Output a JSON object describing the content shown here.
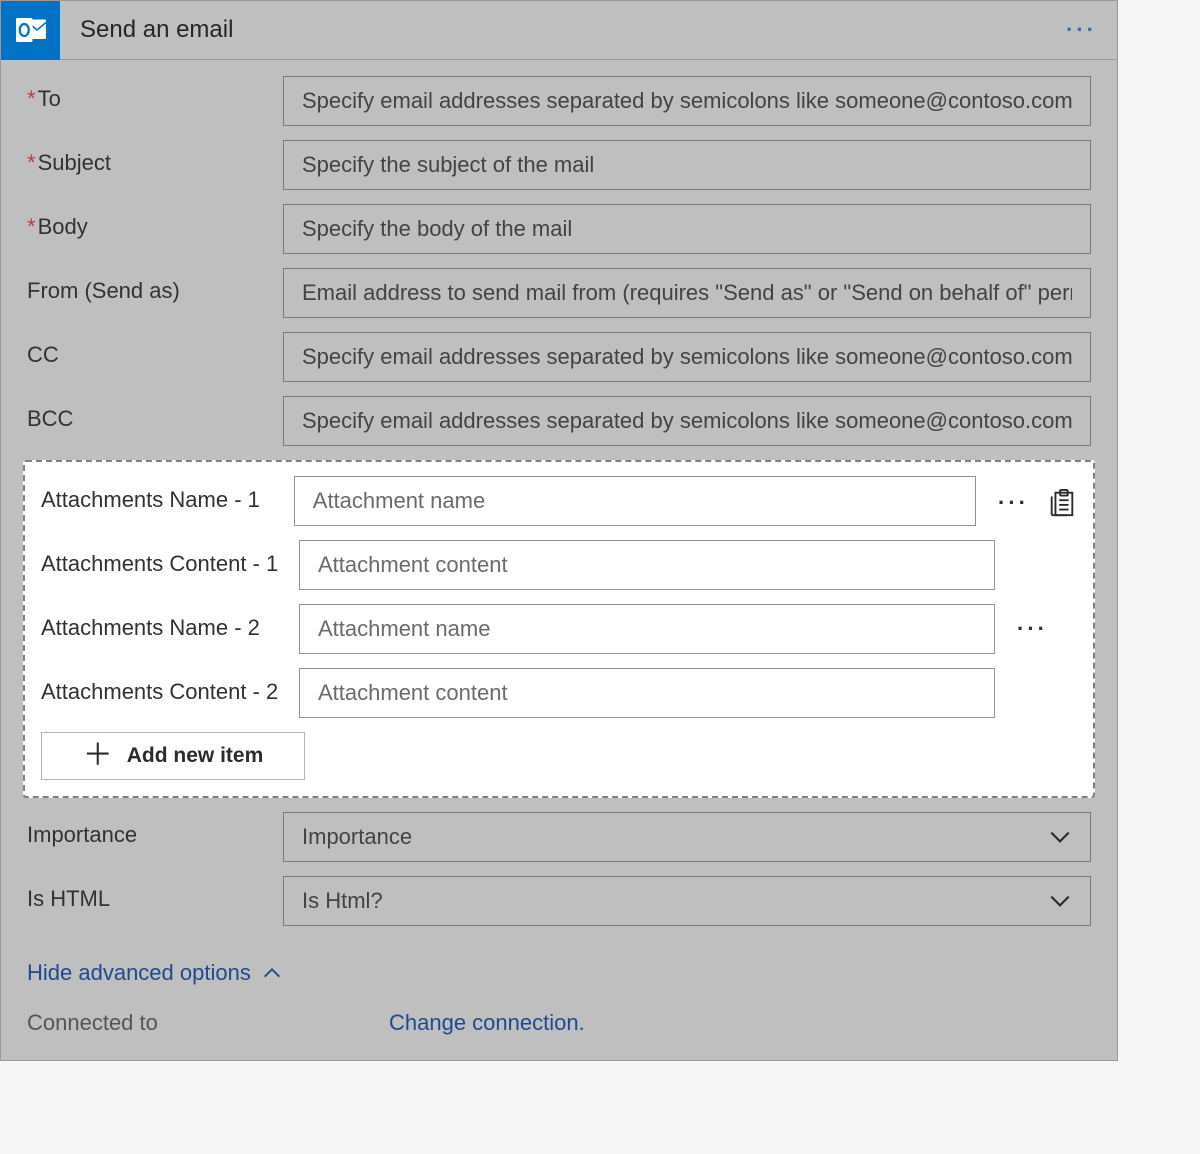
{
  "header": {
    "title": "Send an email"
  },
  "fields": {
    "to": {
      "label": "To",
      "required": true,
      "placeholder": "Specify email addresses separated by semicolons like someone@contoso.com"
    },
    "subject": {
      "label": "Subject",
      "required": true,
      "placeholder": "Specify the subject of the mail"
    },
    "body": {
      "label": "Body",
      "required": true,
      "placeholder": "Specify the body of the mail"
    },
    "from": {
      "label": "From (Send as)",
      "required": false,
      "placeholder": "Email address to send mail from (requires \"Send as\" or \"Send on behalf of\" permission)"
    },
    "cc": {
      "label": "CC",
      "required": false,
      "placeholder": "Specify email addresses separated by semicolons like someone@contoso.com"
    },
    "bcc": {
      "label": "BCC",
      "required": false,
      "placeholder": "Specify email addresses separated by semicolons like someone@contoso.com"
    }
  },
  "attachments": {
    "items": [
      {
        "name_label": "Attachments Name - 1",
        "name_placeholder": "Attachment name",
        "content_label": "Attachments Content - 1",
        "content_placeholder": "Attachment content"
      },
      {
        "name_label": "Attachments Name - 2",
        "name_placeholder": "Attachment name",
        "content_label": "Attachments Content - 2",
        "content_placeholder": "Attachment content"
      }
    ],
    "add_button": "Add new item"
  },
  "importance": {
    "label": "Importance",
    "placeholder": "Importance"
  },
  "is_html": {
    "label": "Is HTML",
    "placeholder": "Is Html?"
  },
  "advanced_toggle": "Hide advanced options",
  "footer": {
    "connected_label": "Connected to",
    "connected_value": "",
    "change_link": "Change connection."
  }
}
